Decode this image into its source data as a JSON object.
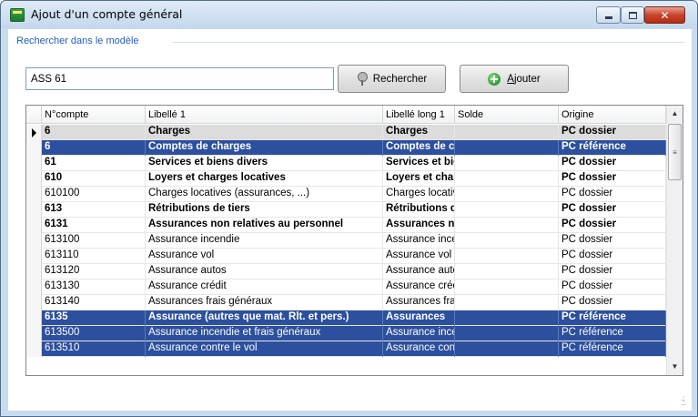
{
  "window": {
    "title": "Ajout d'un compte général",
    "minimize_label": "",
    "maximize_label": "",
    "close_label": "✕"
  },
  "search_group": {
    "legend": "Rechercher dans le modèle",
    "input_value": "ASS 61",
    "search_button": "Rechercher",
    "add_button": "Ajouter"
  },
  "grid": {
    "columns": [
      "N°compte",
      "Libellé 1",
      "Libellé long 1",
      "Solde",
      "Origine"
    ],
    "rows": [
      {
        "num": "6",
        "lib": "Charges",
        "liblong": "Charges",
        "solde": "",
        "origine": "PC dossier",
        "bold": true,
        "state": "current"
      },
      {
        "num": "6",
        "lib": "Comptes de charges",
        "liblong": "Comptes de charges",
        "solde": "",
        "origine": "PC référence",
        "bold": true,
        "state": "selected"
      },
      {
        "num": "61",
        "lib": "Services et biens divers",
        "liblong": "Services et biens divers",
        "solde": "",
        "origine": "PC dossier",
        "bold": true,
        "state": ""
      },
      {
        "num": "610",
        "lib": "Loyers et charges locatives",
        "liblong": "Loyers et charges locatives",
        "solde": "",
        "origine": "PC dossier",
        "bold": true,
        "state": ""
      },
      {
        "num": "610100",
        "lib": "Charges locatives (assurances, ...)",
        "liblong": "Charges locatives",
        "solde": "",
        "origine": "PC dossier",
        "bold": false,
        "state": ""
      },
      {
        "num": "613",
        "lib": "Rétributions de tiers",
        "liblong": "Rétributions de tiers",
        "solde": "",
        "origine": "PC dossier",
        "bold": true,
        "state": ""
      },
      {
        "num": "6131",
        "lib": "Assurances non relatives au personnel",
        "liblong": "Assurances non relatives",
        "solde": "",
        "origine": "PC dossier",
        "bold": true,
        "state": ""
      },
      {
        "num": "613100",
        "lib": "Assurance incendie",
        "liblong": "Assurance incendie",
        "solde": "",
        "origine": "PC dossier",
        "bold": false,
        "state": ""
      },
      {
        "num": "613110",
        "lib": "Assurance vol",
        "liblong": "Assurance vol",
        "solde": "",
        "origine": "PC dossier",
        "bold": false,
        "state": ""
      },
      {
        "num": "613120",
        "lib": "Assurance autos",
        "liblong": "Assurance autos",
        "solde": "",
        "origine": "PC dossier",
        "bold": false,
        "state": ""
      },
      {
        "num": "613130",
        "lib": "Assurance crédit",
        "liblong": "Assurance crédit",
        "solde": "",
        "origine": "PC dossier",
        "bold": false,
        "state": ""
      },
      {
        "num": "613140",
        "lib": "Assurances frais généraux",
        "liblong": "Assurances frais généraux",
        "solde": "",
        "origine": "PC dossier",
        "bold": false,
        "state": ""
      },
      {
        "num": "6135",
        "lib": "Assurance (autres que mat. Rlt. et pers.)",
        "liblong": "Assurances",
        "solde": "",
        "origine": "PC référence",
        "bold": true,
        "state": "selected"
      },
      {
        "num": "613500",
        "lib": "Assurance incendie et frais généraux",
        "liblong": "Assurance incendie",
        "solde": "",
        "origine": "PC référence",
        "bold": false,
        "state": "selected"
      },
      {
        "num": "613510",
        "lib": "Assurance contre le vol",
        "liblong": "Assurance contre le vol",
        "solde": "",
        "origine": "PC référence",
        "bold": false,
        "state": "selected"
      }
    ]
  },
  "colors": {
    "selection": "#2c4f9e",
    "legend": "#1e5fbf",
    "frame": "#c9dcee"
  }
}
